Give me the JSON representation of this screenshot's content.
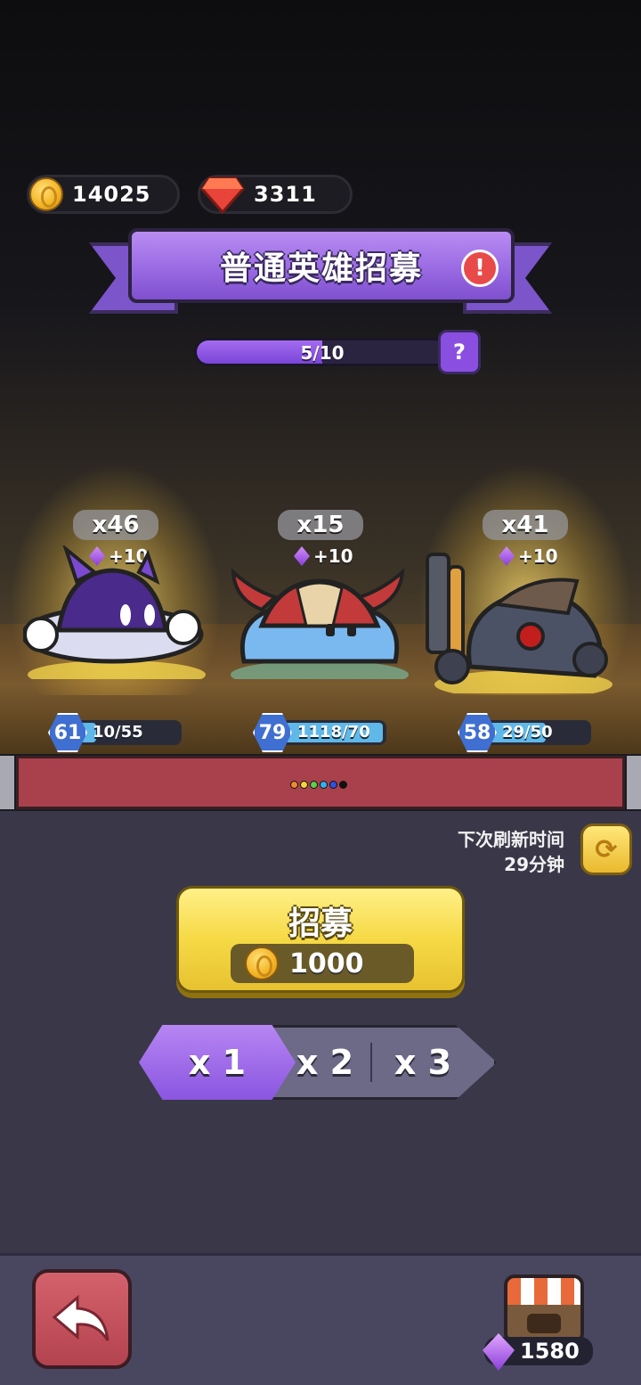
{
  "currencies": {
    "coins": "14025",
    "rubies": "3311"
  },
  "banner": {
    "title": "普通英雄招募",
    "alert": "!"
  },
  "progress": {
    "text": "5/10",
    "fraction": 0.5,
    "help": "?"
  },
  "heroes": [
    {
      "count": "x46",
      "bonus": "+10",
      "level": "61",
      "xp": "10/55",
      "xp_fraction": 0.18
    },
    {
      "count": "x15",
      "bonus": "+10",
      "level": "79",
      "xp": "1118/70",
      "xp_fraction": 1.0
    },
    {
      "count": "x41",
      "bonus": "+10",
      "level": "58",
      "xp": "29/50",
      "xp_fraction": 0.58
    }
  ],
  "pagination_dot_colors": [
    "#f08a2c",
    "#f5d53a",
    "#5bd04f",
    "#2fb0f0",
    "#3050e0",
    "#111111"
  ],
  "refresh": {
    "label": "下次刷新时间",
    "time": "29分钟"
  },
  "recruit": {
    "label": "招募",
    "cost": "1000"
  },
  "multipliers": [
    "x 1",
    "x 2",
    "x 3"
  ],
  "selected_multiplier": "x 1",
  "footer": {
    "gems": "1580"
  }
}
